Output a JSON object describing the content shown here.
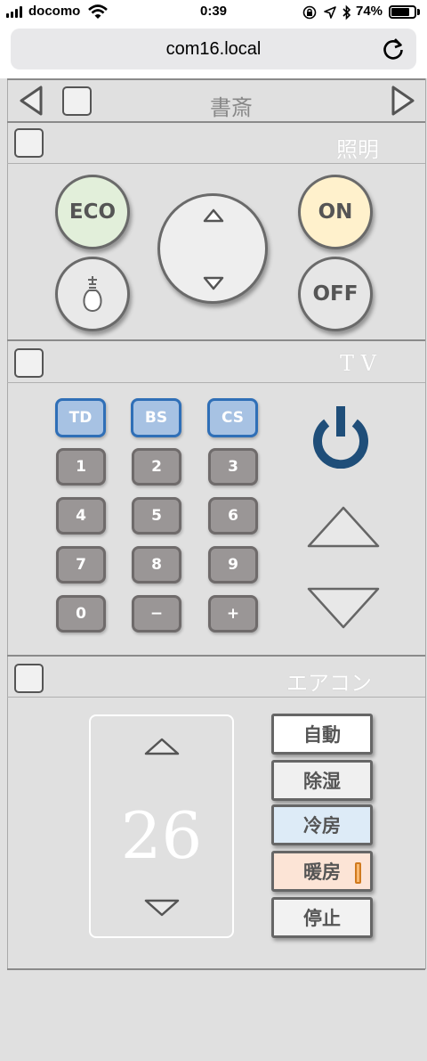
{
  "status_bar": {
    "carrier": "docomo",
    "time": "0:39",
    "battery_text": "74%",
    "battery_level": 0.74
  },
  "browser": {
    "url": "com16.local"
  },
  "room": {
    "name": "書斎"
  },
  "lighting": {
    "title": "照明",
    "eco_label": "ECO",
    "on_label": "ON",
    "off_label": "OFF",
    "colors": {
      "eco": "#e2efda",
      "on": "#fff1cc",
      "off": "#e6e6e6"
    }
  },
  "tv": {
    "title": "T V",
    "broadcast_keys": [
      "TD",
      "BS",
      "CS"
    ],
    "number_keys": [
      "1",
      "2",
      "3",
      "4",
      "5",
      "6",
      "7",
      "8",
      "9",
      "0",
      "−",
      "+"
    ],
    "power_color": "#1f4e79"
  },
  "aircon": {
    "title": "エアコン",
    "temperature": "26",
    "modes": [
      {
        "label": "自動",
        "bg": "#ffffff",
        "active": false
      },
      {
        "label": "除湿",
        "bg": "#f0f0f0",
        "active": false
      },
      {
        "label": "冷房",
        "bg": "#ddebf7",
        "active": false
      },
      {
        "label": "暖房",
        "bg": "#fce4d6",
        "active": true
      },
      {
        "label": "停止",
        "bg": "#f2f2f2",
        "active": false
      }
    ]
  }
}
